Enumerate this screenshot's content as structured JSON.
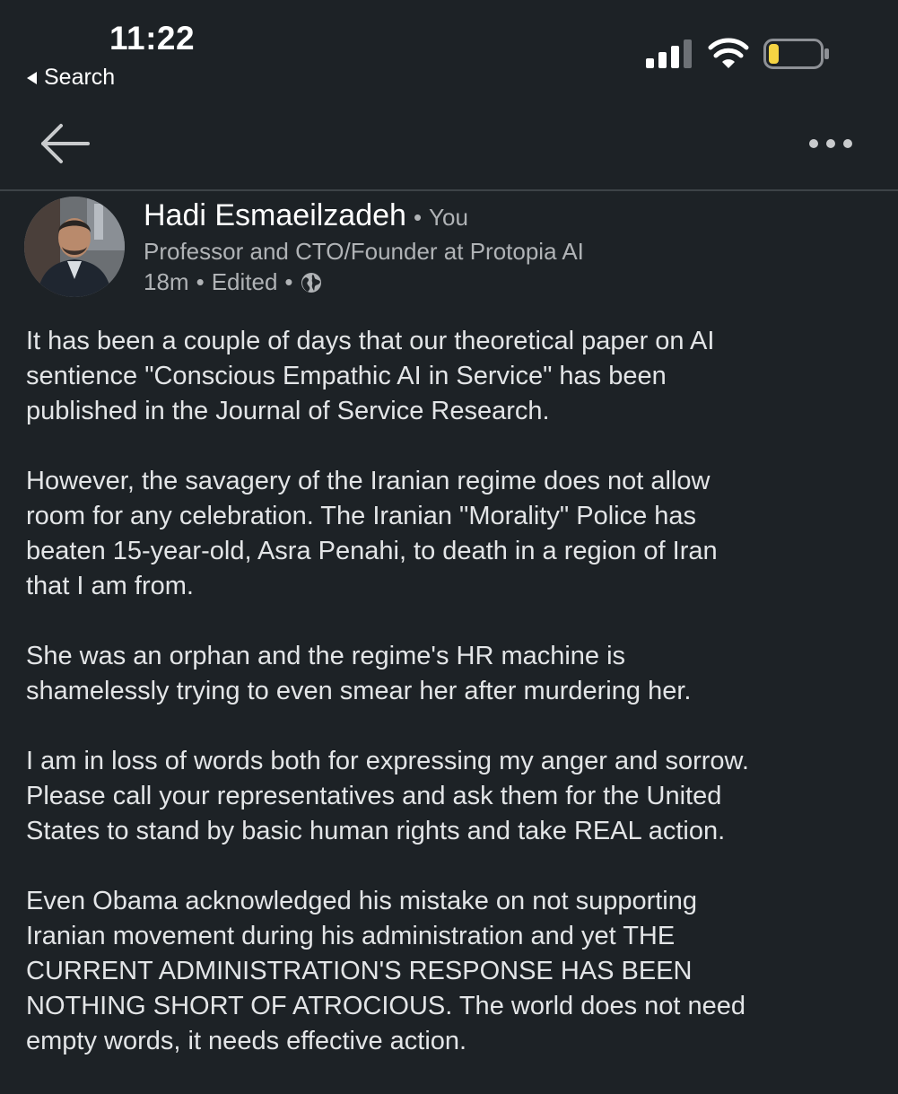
{
  "status_bar": {
    "time": "11:22",
    "back_to_app": "Search",
    "icons": [
      "cellular-signal-icon",
      "wifi-icon",
      "battery-icon"
    ],
    "battery_level": 0.2,
    "battery_color": "#f5d443"
  },
  "nav": {
    "back_icon": "left-arrow-icon",
    "more_icon": "more-horizontal-icon"
  },
  "post": {
    "author": {
      "name": "Hadi Esmaeilzadeh",
      "separator": "•",
      "relation": "You",
      "headline": "Professor and CTO/Founder at Protopia AI",
      "time": "18m",
      "sep1": "•",
      "edited": "Edited",
      "sep2": "•",
      "visibility_icon": "globe-icon"
    },
    "paragraphs": [
      "It has been a couple of days that our theoretical paper on AI\nsentience \"Conscious Empathic AI in Service\" has been\npublished in the Journal of Service Research.",
      "However, the savagery of the Iranian regime does not allow\nroom for any celebration. The Iranian \"Morality\" Police has\nbeaten 15-year-old, Asra Penahi, to death in a region of Iran\nthat I am from.",
      "She was an orphan and the regime's HR machine is\nshamelessly  trying to even smear her after murdering her.",
      "I am in loss of words both for expressing my anger and sorrow.\nPlease call your representatives and ask them for the United\nStates to stand by basic human rights and take REAL action.",
      "Even Obama acknowledged his mistake on not supporting\nIranian movement during his administration and yet THE\nCURRENT ADMINISTRATION'S RESPONSE HAS BEEN\nNOTHING SHORT OF ATROCIOUS. The world does not need\nempty words, it needs effective action."
    ]
  },
  "colors": {
    "background": "#1d2226",
    "text_primary": "#ffffff",
    "text_secondary": "#b0b3b6",
    "divider": "#3d4347"
  }
}
